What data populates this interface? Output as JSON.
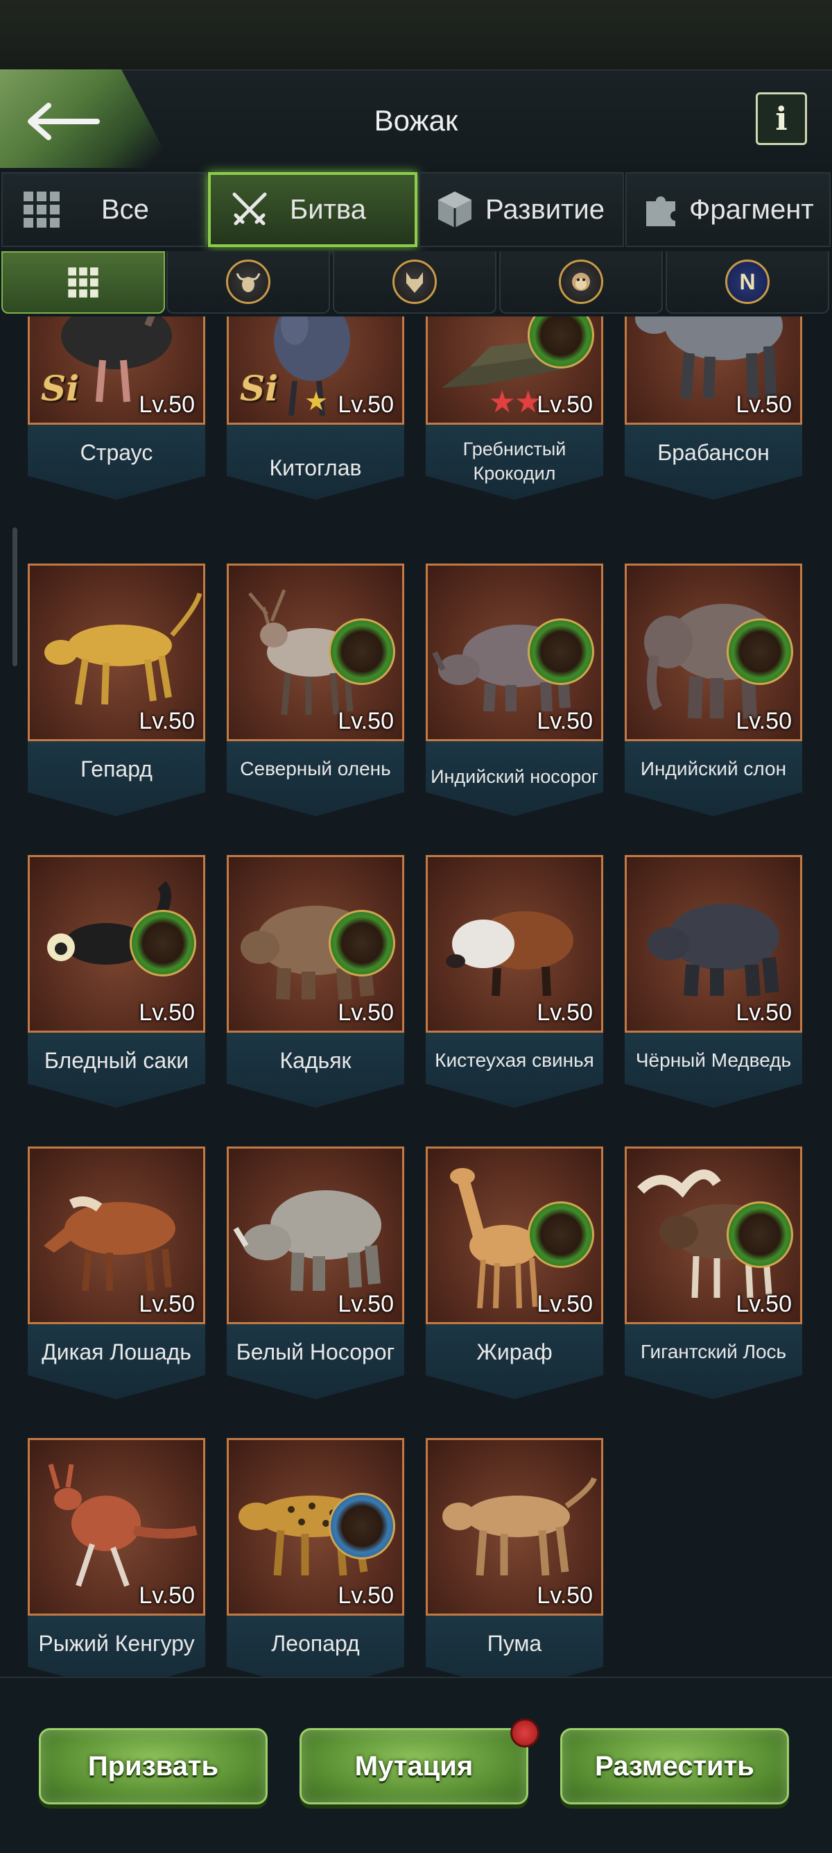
{
  "header": {
    "title": "Вожак",
    "info_label": "i"
  },
  "tabs": [
    {
      "label": "Все",
      "icon": "grid-icon",
      "active": false
    },
    {
      "label": "Битва",
      "icon": "crossed-swords-icon",
      "active": true
    },
    {
      "label": "Развитие",
      "icon": "cube-icon",
      "active": false
    },
    {
      "label": "Фрагмент",
      "icon": "puzzle-icon",
      "active": false
    }
  ],
  "subtabs": [
    {
      "icon": "grid-icon",
      "active": true
    },
    {
      "icon": "bull-icon",
      "active": false
    },
    {
      "icon": "wolf-icon",
      "active": false
    },
    {
      "icon": "monkey-icon",
      "active": false
    },
    {
      "icon": "n-letter-icon",
      "label": "N",
      "active": false
    }
  ],
  "animals": [
    {
      "name": "Страус",
      "level": "Lv.50",
      "si": "Si",
      "stars": 0
    },
    {
      "name": "Китоглав",
      "level": "Lv.50",
      "si": "Si",
      "stars": 1
    },
    {
      "name": "Гребнистый Крокодил",
      "level": "Lv.50",
      "badge": "green",
      "stars": 2
    },
    {
      "name": "Брабансон",
      "level": "Lv.50",
      "stars": 0
    },
    {
      "name": "Гепард",
      "level": "Lv.50",
      "stars": 0
    },
    {
      "name": "Северный олень",
      "level": "Lv.50",
      "badge": "green",
      "stars": 0
    },
    {
      "name": "Индийский носорог",
      "level": "Lv.50",
      "badge": "green",
      "stars": 0
    },
    {
      "name": "Индийский слон",
      "level": "Lv.50",
      "badge": "green",
      "stars": 0
    },
    {
      "name": "Бледный саки",
      "level": "Lv.50",
      "badge": "green",
      "stars": 0
    },
    {
      "name": "Кадьяк",
      "level": "Lv.50",
      "badge": "green",
      "stars": 0
    },
    {
      "name": "Кистеухая свинья",
      "level": "Lv.50",
      "stars": 0
    },
    {
      "name": "Чёрный Медведь",
      "level": "Lv.50",
      "stars": 0
    },
    {
      "name": "Дикая Лошадь",
      "level": "Lv.50",
      "stars": 0
    },
    {
      "name": "Белый Носорог",
      "level": "Lv.50",
      "stars": 0
    },
    {
      "name": "Жираф",
      "level": "Lv.50",
      "badge": "green",
      "stars": 0
    },
    {
      "name": "Гигантский Лось",
      "level": "Lv.50",
      "badge": "green",
      "stars": 0
    },
    {
      "name": "Рыжий Кенгуру",
      "level": "Lv.50",
      "stars": 0
    },
    {
      "name": "Леопард",
      "level": "Lv.50",
      "badge": "blue",
      "stars": 0
    },
    {
      "name": "Пума",
      "level": "Lv.50",
      "stars": 0
    }
  ],
  "buttons": {
    "summon": "Призвать",
    "mutation": "Мутация",
    "deploy": "Разместить"
  },
  "colors": {
    "accent_green": "#8fcb4c",
    "card_border": "#c27a45",
    "nameplate": "#1c3644"
  }
}
